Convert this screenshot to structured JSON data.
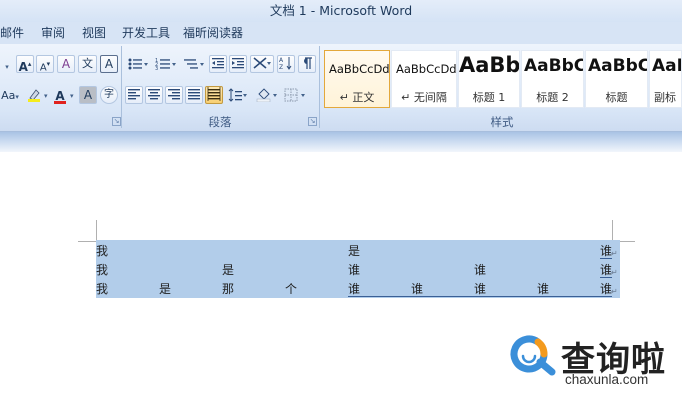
{
  "window": {
    "title": "文档 1 - Microsoft Word"
  },
  "menu": {
    "items": [
      {
        "label": "邮件"
      },
      {
        "label": "审阅"
      },
      {
        "label": "视图"
      },
      {
        "label": "开发工具"
      },
      {
        "label": "福昕阅读器"
      }
    ]
  },
  "ribbon": {
    "groups": {
      "paragraph": {
        "label": "段落"
      },
      "styles": {
        "label": "样式"
      }
    },
    "font_buttons": {
      "grow": "A",
      "shrink": "A",
      "clear": "A",
      "phonetic": "文",
      "border_char": "A",
      "aa": "Aa",
      "highlight": "ab",
      "font_color": "A",
      "shading": "A",
      "enclose": "字"
    },
    "dropdown_arrow": "▾",
    "styles": [
      {
        "sample": "AaBbCcDdI",
        "name": "↵ 正文",
        "selected": true
      },
      {
        "sample": "AaBbCcDdI",
        "name": "↵ 无间隔",
        "selected": false
      },
      {
        "sample": "AaBb",
        "name": "标题 1",
        "selected": false
      },
      {
        "sample": "AaBbC",
        "name": "标题 2",
        "selected": false
      },
      {
        "sample": "AaBbC",
        "name": "标题",
        "selected": false
      },
      {
        "sample": "AaB",
        "name": "副标",
        "selected": false
      }
    ]
  },
  "document": {
    "rows": [
      {
        "cells": [
          "我",
          "是",
          "谁"
        ],
        "mark": "↵"
      },
      {
        "cells": [
          "我",
          "是",
          "谁",
          "谁",
          "谁"
        ],
        "mark": "↵"
      },
      {
        "cells": [
          "我",
          "是",
          "那",
          "个",
          "谁",
          "谁",
          "谁",
          "谁",
          "谁"
        ],
        "mark": "↵"
      }
    ]
  },
  "watermark": {
    "brand": "查询啦",
    "domain": "chaxunla.com",
    "colors": {
      "blue": "#3b8fd9",
      "orange": "#f39a1e"
    }
  }
}
